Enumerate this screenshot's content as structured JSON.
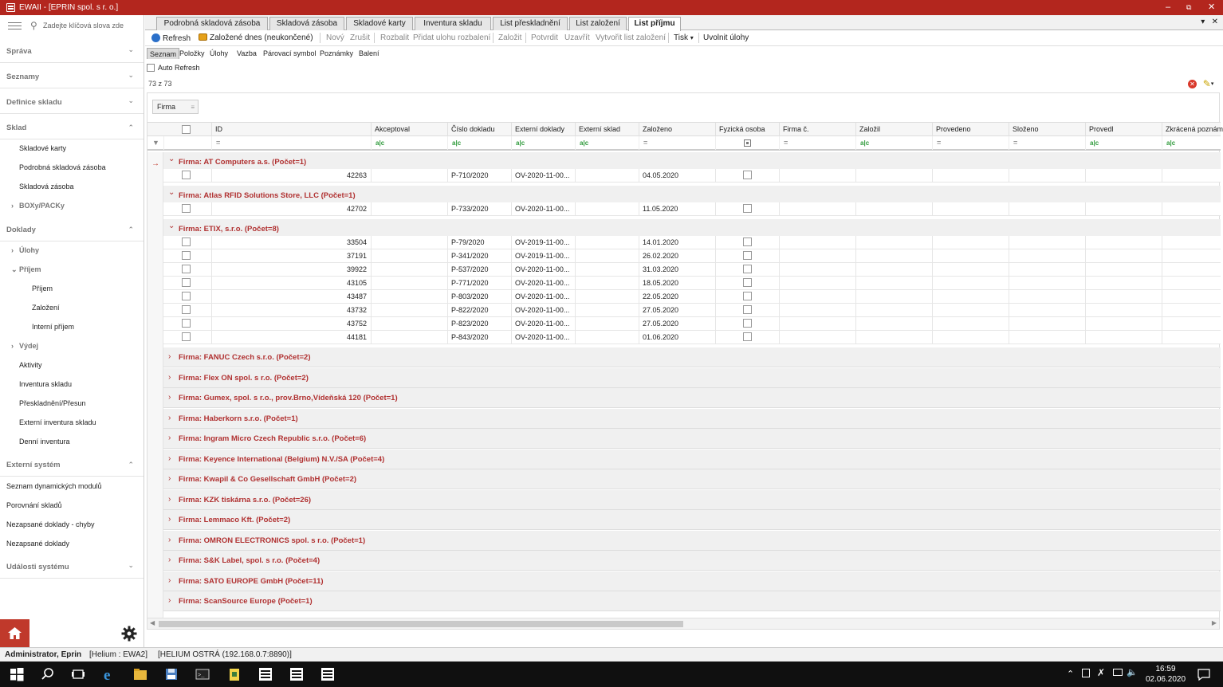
{
  "window": {
    "title": "EWAII - [EPRIN spol. s r. o.]"
  },
  "sidebar": {
    "search_placeholder": "Zadejte klíčová slova zde",
    "sections": [
      {
        "label": "Správa",
        "open": false
      },
      {
        "label": "Seznamy",
        "open": false
      },
      {
        "label": "Definice skladu",
        "open": false
      },
      {
        "label": "Sklad",
        "open": true
      },
      {
        "label": "Doklady",
        "open": true
      },
      {
        "label": "Externí systém",
        "open": true
      },
      {
        "label": "Události systému",
        "open": false
      }
    ],
    "sklad_items": [
      "Skladové karty",
      "Podrobná skladová zásoba",
      "Skladová zásoba",
      "BOXy/PACKy"
    ],
    "doklady_items": [
      "Úlohy",
      "Příjem",
      "Příjem",
      "Založení",
      "Interní příjem",
      "Výdej",
      "Aktivity",
      "Inventura skladu",
      "Přeskladnění/Přesun",
      "Externí inventura skladu",
      "Denní inventura"
    ],
    "externi_items": [
      "Seznam dynamických modulů",
      "Porovnání skladů",
      "Nezapsané doklady - chyby",
      "Nezapsané doklady"
    ]
  },
  "tabs": [
    {
      "label": "Podrobná skladová zásoba",
      "active": false
    },
    {
      "label": "Skladová zásoba",
      "active": false
    },
    {
      "label": "Skladové karty",
      "active": false
    },
    {
      "label": "Inventura skladu",
      "active": false
    },
    {
      "label": "List přeskladnění",
      "active": false
    },
    {
      "label": "List založení",
      "active": false
    },
    {
      "label": "List příjmu",
      "active": true
    }
  ],
  "toolbar": {
    "refresh": "Refresh",
    "zalozene_dnes": "Založené dnes (neukončené)",
    "novy": "Nový",
    "zrusit": "Zrušit",
    "rozbalit": "Rozbalit",
    "pridat": "Přidat ulohu rozbalení",
    "zalozit": "Založit",
    "potvrdit": "Potvrdit",
    "uzavrit": "Uzavřít",
    "vytvorit": "Vytvořit list založení",
    "tisk": "Tisk",
    "uvolnit": "Uvolnit úlohy"
  },
  "subtabs": [
    "Seznam",
    "Položky",
    "Úlohy",
    "Vazba",
    "Párovací symbol",
    "Poznámky",
    "Balení"
  ],
  "auto_refresh": "Auto Refresh",
  "record_count": "73 z 73",
  "group_chip": "Firma",
  "columns": [
    "ID",
    "Akceptoval",
    "Číslo dokladu",
    "Externí doklady",
    "Externí sklad",
    "Založeno",
    "Fyzická osoba",
    "Firma č.",
    "Založil",
    "Provedeno",
    "Složeno",
    "Provedl",
    "Zkrácená poznámk"
  ],
  "groups": [
    {
      "title": "Firma: AT Computers a.s. (Počet=1)",
      "expanded": true,
      "rows": [
        {
          "id": "42263",
          "doc": "P-710/2020",
          "ext": "OV-2020-11-00...",
          "date": "04.05.2020"
        }
      ]
    },
    {
      "title": "Firma: Atlas RFID Solutions Store, LLC (Počet=1)",
      "expanded": true,
      "rows": [
        {
          "id": "42702",
          "doc": "P-733/2020",
          "ext": "OV-2020-11-00...",
          "date": "11.05.2020"
        }
      ]
    },
    {
      "title": "Firma: ETIX, s.r.o. (Počet=8)",
      "expanded": true,
      "rows": [
        {
          "id": "33504",
          "doc": "P-79/2020",
          "ext": "OV-2019-11-00...",
          "date": "14.01.2020"
        },
        {
          "id": "37191",
          "doc": "P-341/2020",
          "ext": "OV-2019-11-00...",
          "date": "26.02.2020"
        },
        {
          "id": "39922",
          "doc": "P-537/2020",
          "ext": "OV-2020-11-00...",
          "date": "31.03.2020"
        },
        {
          "id": "43105",
          "doc": "P-771/2020",
          "ext": "OV-2020-11-00...",
          "date": "18.05.2020"
        },
        {
          "id": "43487",
          "doc": "P-803/2020",
          "ext": "OV-2020-11-00...",
          "date": "22.05.2020"
        },
        {
          "id": "43732",
          "doc": "P-822/2020",
          "ext": "OV-2020-11-00...",
          "date": "27.05.2020"
        },
        {
          "id": "43752",
          "doc": "P-823/2020",
          "ext": "OV-2020-11-00...",
          "date": "27.05.2020"
        },
        {
          "id": "44181",
          "doc": "P-843/2020",
          "ext": "OV-2020-11-00...",
          "date": "01.06.2020"
        }
      ]
    },
    {
      "title": "Firma: FANUC Czech s.r.o. (Počet=2)",
      "expanded": false,
      "rows": []
    },
    {
      "title": "Firma: Flex ON spol. s r.o. (Počet=2)",
      "expanded": false,
      "rows": []
    },
    {
      "title": "Firma: Gumex, spol. s r.o., prov.Brno,Vídeňská 120 (Počet=1)",
      "expanded": false,
      "rows": []
    },
    {
      "title": "Firma: Haberkorn s.r.o. (Počet=1)",
      "expanded": false,
      "rows": []
    },
    {
      "title": "Firma: Ingram Micro Czech Republic s.r.o. (Počet=6)",
      "expanded": false,
      "rows": []
    },
    {
      "title": "Firma: Keyence International (Belgium) N.V./SA (Počet=4)",
      "expanded": false,
      "rows": []
    },
    {
      "title": "Firma: Kwapil & Co Gesellschaft GmbH (Počet=2)",
      "expanded": false,
      "rows": []
    },
    {
      "title": "Firma: KZK tiskárna s.r.o. (Počet=26)",
      "expanded": false,
      "rows": []
    },
    {
      "title": "Firma: Lemmaco Kft. (Počet=2)",
      "expanded": false,
      "rows": []
    },
    {
      "title": "Firma: OMRON ELECTRONICS spol. s r.o. (Počet=1)",
      "expanded": false,
      "rows": []
    },
    {
      "title": "Firma: S&K Label, spol. s r.o. (Počet=4)",
      "expanded": false,
      "rows": []
    },
    {
      "title": "Firma: SATO EUROPE GmbH (Počet=11)",
      "expanded": false,
      "rows": []
    },
    {
      "title": "Firma: ScanSource Europe (Počet=1)",
      "expanded": false,
      "rows": []
    }
  ],
  "statusbar": {
    "user": "Administrator, Eprin",
    "helium": "[Helium : EWA2]",
    "server": "[HELIUM OSTRÁ (192.168.0.7:8890)]"
  },
  "taskbar": {
    "time": "16:59",
    "date": "02.06.2020"
  },
  "colors": {
    "accent": "#b3261e",
    "group_text": "#b03030",
    "filter_link": "#2e9a3a"
  }
}
